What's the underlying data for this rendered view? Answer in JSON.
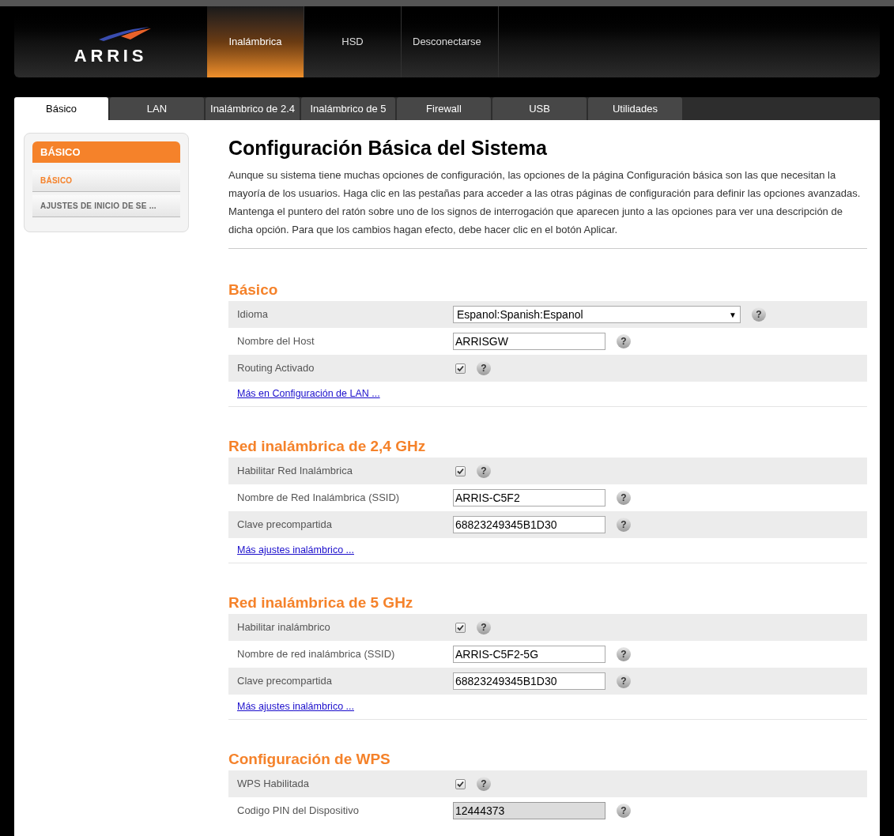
{
  "logo": "ARRIS",
  "nav": [
    {
      "label": "Inalámbrica",
      "selected": true
    },
    {
      "label": "HSD",
      "selected": false
    },
    {
      "label": "Desconectarse",
      "selected": false
    }
  ],
  "tabs": [
    {
      "label": "Básico",
      "selected": true
    },
    {
      "label": "LAN",
      "selected": false
    },
    {
      "label": "Inalámbrico de 2.4",
      "selected": false
    },
    {
      "label": "Inalámbrico de 5",
      "selected": false
    },
    {
      "label": "Firewall",
      "selected": false
    },
    {
      "label": "USB",
      "selected": false
    },
    {
      "label": "Utilidades",
      "selected": false
    }
  ],
  "sidebar": {
    "title": "BÁSICO",
    "items": [
      {
        "label": "BÁSICO",
        "selected": true
      },
      {
        "label": "AJUSTES DE INICIO DE SE ...",
        "selected": false
      }
    ]
  },
  "page": {
    "title": "Configuración Básica del Sistema",
    "description": "Aunque su sistema tiene muchas opciones de configuración, las opciones de la página Configuración básica son las que necesitan la mayoría de los usuarios. Haga clic en las pestañas para acceder a las otras páginas de configuración para definir las opciones avanzadas. Mantenga el puntero del ratón sobre uno de los signos de interrogación que aparecen junto a las opciones para ver una descripción de dicha opción. Para que los cambios hagan efecto, debe hacer clic en el botón Aplicar."
  },
  "sections": [
    {
      "title": "Básico",
      "rows": [
        {
          "kind": "select",
          "label": "Idioma",
          "value": "Espanol:Spanish:Espanol",
          "caret": "▼",
          "help": "?"
        },
        {
          "kind": "text",
          "label": "Nombre del Host",
          "value": "ARRISGW",
          "disabled": false,
          "help": "?"
        },
        {
          "kind": "checkbox",
          "label": "Routing Activado",
          "checked": true,
          "help": "?"
        }
      ],
      "link": "Más en Configuración de LAN ..."
    },
    {
      "title": "Red inalámbrica de 2,4 GHz",
      "rows": [
        {
          "kind": "checkbox",
          "label": "Habilitar Red Inalámbrica",
          "checked": true,
          "help": "?"
        },
        {
          "kind": "text",
          "label": "Nombre de Red Inalámbrica (SSID)",
          "value": "ARRIS-C5F2",
          "disabled": false,
          "help": "?"
        },
        {
          "kind": "text",
          "label": "Clave precompartida",
          "value": "68823249345B1D30",
          "disabled": false,
          "help": "?"
        }
      ],
      "link": "Más ajustes inalámbrico ..."
    },
    {
      "title": "Red inalámbrica de 5 GHz",
      "rows": [
        {
          "kind": "checkbox",
          "label": "Habilitar inalámbrico",
          "checked": true,
          "help": "?"
        },
        {
          "kind": "text",
          "label": "Nombre de red inalámbrica (SSID)",
          "value": "ARRIS-C5F2-5G",
          "disabled": false,
          "help": "?"
        },
        {
          "kind": "text",
          "label": "Clave precompartida",
          "value": "68823249345B1D30",
          "disabled": false,
          "help": "?"
        }
      ],
      "link": "Más ajustes inalámbrico ..."
    },
    {
      "title": "Configuración de WPS",
      "rows": [
        {
          "kind": "checkbox",
          "label": "WPS Habilitada",
          "checked": true,
          "help": "?"
        },
        {
          "kind": "text",
          "label": "Codigo PIN del Dispositivo",
          "value": "12444373",
          "disabled": true,
          "help": "?"
        }
      ]
    }
  ]
}
